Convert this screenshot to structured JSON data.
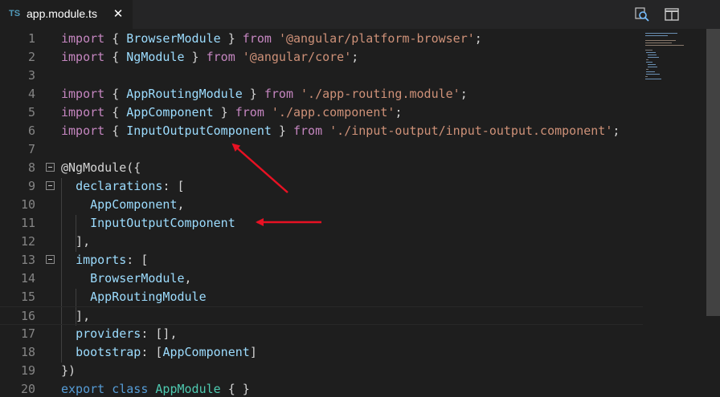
{
  "tab": {
    "lang": "TS",
    "title": "app.module.ts",
    "close": "✕"
  },
  "toolbar": [
    "open-changes-icon",
    "split-editor-icon"
  ],
  "colors": {
    "keyword": "#569cd6",
    "import": "#c586c0",
    "string": "#ce9178",
    "identifier": "#9cdcfe",
    "class": "#4ec9b0",
    "annotation_arrow": "#e81123"
  },
  "lines": [
    {
      "n": "1",
      "t": [
        [
          "import",
          "kw2"
        ],
        [
          " { ",
          "pl"
        ],
        [
          "BrowserModule",
          "id"
        ],
        [
          " } ",
          "pl"
        ],
        [
          "from",
          "kw2"
        ],
        [
          " ",
          "pl"
        ],
        [
          "'@angular/platform-browser'",
          "str"
        ],
        [
          ";",
          "pl"
        ]
      ]
    },
    {
      "n": "2",
      "t": [
        [
          "import",
          "kw2"
        ],
        [
          " { ",
          "pl"
        ],
        [
          "NgModule",
          "id"
        ],
        [
          " } ",
          "pl"
        ],
        [
          "from",
          "kw2"
        ],
        [
          " ",
          "pl"
        ],
        [
          "'@angular/core'",
          "str"
        ],
        [
          ";",
          "pl"
        ]
      ]
    },
    {
      "n": "3",
      "t": []
    },
    {
      "n": "4",
      "t": [
        [
          "import",
          "kw2"
        ],
        [
          " { ",
          "pl"
        ],
        [
          "AppRoutingModule",
          "id"
        ],
        [
          " } ",
          "pl"
        ],
        [
          "from",
          "kw2"
        ],
        [
          " ",
          "pl"
        ],
        [
          "'./app-routing.module'",
          "str"
        ],
        [
          ";",
          "pl"
        ]
      ]
    },
    {
      "n": "5",
      "t": [
        [
          "import",
          "kw2"
        ],
        [
          " { ",
          "pl"
        ],
        [
          "AppComponent",
          "id"
        ],
        [
          " } ",
          "pl"
        ],
        [
          "from",
          "kw2"
        ],
        [
          " ",
          "pl"
        ],
        [
          "'./app.component'",
          "str"
        ],
        [
          ";",
          "pl"
        ]
      ]
    },
    {
      "n": "6",
      "t": [
        [
          "import",
          "kw2"
        ],
        [
          " { ",
          "pl"
        ],
        [
          "InputOutputComponent",
          "id"
        ],
        [
          " } ",
          "pl"
        ],
        [
          "from",
          "kw2"
        ],
        [
          " ",
          "pl"
        ],
        [
          "'./input-output/input-output.component'",
          "str"
        ],
        [
          ";",
          "pl"
        ]
      ]
    },
    {
      "n": "7",
      "t": []
    },
    {
      "n": "8",
      "t": [
        [
          "@NgModule",
          "pl"
        ],
        [
          "({",
          "pl"
        ]
      ]
    },
    {
      "n": "9",
      "t": [
        [
          "  ",
          "pl"
        ],
        [
          "declarations",
          "id"
        ],
        [
          ": [",
          "pl"
        ]
      ]
    },
    {
      "n": "10",
      "t": [
        [
          "    ",
          "pl"
        ],
        [
          "AppComponent",
          "id"
        ],
        [
          ",",
          "pl"
        ]
      ]
    },
    {
      "n": "11",
      "t": [
        [
          "    ",
          "pl"
        ],
        [
          "InputOutputComponent",
          "id"
        ]
      ]
    },
    {
      "n": "12",
      "t": [
        [
          "  ],",
          "pl"
        ]
      ]
    },
    {
      "n": "13",
      "t": [
        [
          "  ",
          "pl"
        ],
        [
          "imports",
          "id"
        ],
        [
          ": [",
          "pl"
        ]
      ]
    },
    {
      "n": "14",
      "t": [
        [
          "    ",
          "pl"
        ],
        [
          "BrowserModule",
          "id"
        ],
        [
          ",",
          "pl"
        ]
      ]
    },
    {
      "n": "15",
      "t": [
        [
          "    ",
          "pl"
        ],
        [
          "AppRoutingModule",
          "id"
        ]
      ]
    },
    {
      "n": "16",
      "t": [
        [
          "  ],",
          "pl"
        ]
      ]
    },
    {
      "n": "17",
      "t": [
        [
          "  ",
          "pl"
        ],
        [
          "providers",
          "id"
        ],
        [
          ": [],",
          "pl"
        ]
      ]
    },
    {
      "n": "18",
      "t": [
        [
          "  ",
          "pl"
        ],
        [
          "bootstrap",
          "id"
        ],
        [
          ": [",
          "pl"
        ],
        [
          "AppComponent",
          "id"
        ],
        [
          "]",
          "pl"
        ]
      ]
    },
    {
      "n": "19",
      "t": [
        [
          "})",
          "pl"
        ]
      ]
    },
    {
      "n": "20",
      "t": [
        [
          "export",
          "kw"
        ],
        [
          " ",
          "pl"
        ],
        [
          "class",
          "kw"
        ],
        [
          " ",
          "pl"
        ],
        [
          "AppModule",
          "cls"
        ],
        [
          " { }",
          "pl"
        ]
      ]
    }
  ],
  "folds": [
    "8",
    "9",
    "13"
  ],
  "current_line": "16"
}
